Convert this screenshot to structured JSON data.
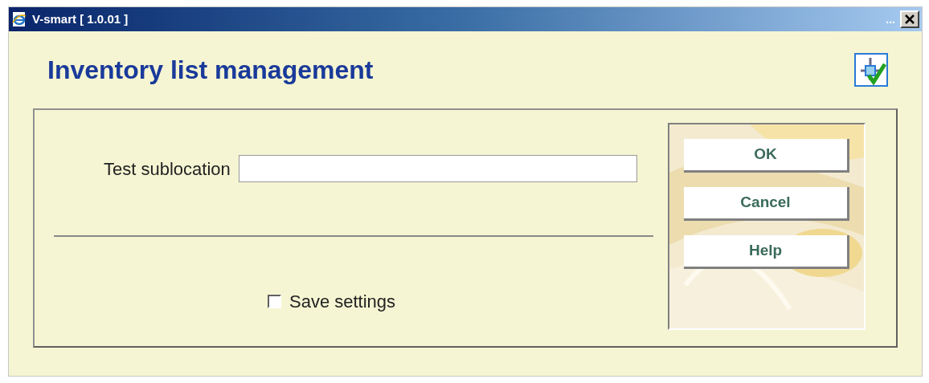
{
  "window": {
    "title": "V-smart [ 1.0.01 ]",
    "title_ellipsis": "..."
  },
  "heading": "Inventory list management",
  "form": {
    "field_label": "Test sublocation",
    "save_settings": {
      "label": "Save settings",
      "checked": false
    }
  },
  "buttons": [
    {
      "label": "OK"
    },
    {
      "label": "Cancel"
    },
    {
      "label": "Help"
    }
  ]
}
